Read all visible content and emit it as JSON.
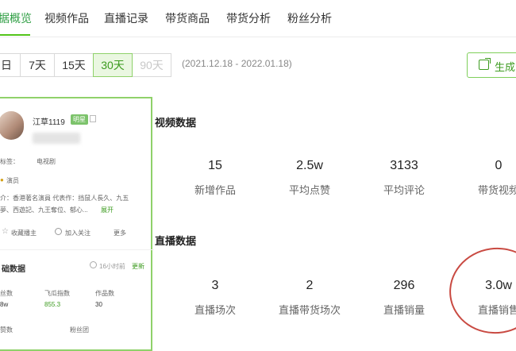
{
  "tabs": [
    "据概览",
    "视频作品",
    "直播记录",
    "带货商品",
    "带货分析",
    "粉丝分析"
  ],
  "range_buttons": [
    "昨日",
    "7天",
    "15天",
    "30天",
    "90天"
  ],
  "range_labels_visible": [
    "日",
    "7天",
    "15天",
    "30天",
    "90天"
  ],
  "date_range": "(2021.12.18 - 2022.01.18)",
  "generate_button": "生成",
  "profile": {
    "name": "江草1119",
    "badge": "明星",
    "tag_label": "标签：",
    "tag_value": "电视剧",
    "role": "演员",
    "bio": "介：香港著名演員 代表作：挡鼠人長久、九五",
    "bio2": "夢、西遊記、九王奪位、郁心...",
    "expand": "展开",
    "favorite": "收藏播主",
    "follow": "加入关注",
    "more": "更多",
    "data_title": "础数据",
    "update_time": "16小时前",
    "update": "更新",
    "stats_labels": [
      "丝数",
      "飞瓜指数",
      "作品数"
    ],
    "stats_values": [
      "8w",
      "855.3",
      "30"
    ],
    "stats_labels2": [
      "赞数",
      "粉丝团"
    ]
  },
  "video_section": {
    "title": "视频数据",
    "metrics": [
      {
        "value": "15",
        "label": "新增作品"
      },
      {
        "value": "2.5w",
        "label": "平均点赞"
      },
      {
        "value": "3133",
        "label": "平均评论"
      },
      {
        "value": "0",
        "label": "带货视频"
      }
    ]
  },
  "live_section": {
    "title": "直播数据",
    "metrics": [
      {
        "value": "3",
        "label": "直播场次"
      },
      {
        "value": "2",
        "label": "直播带货场次"
      },
      {
        "value": "296",
        "label": "直播销量"
      },
      {
        "value": "3.0w",
        "label": "直播销售"
      }
    ]
  }
}
